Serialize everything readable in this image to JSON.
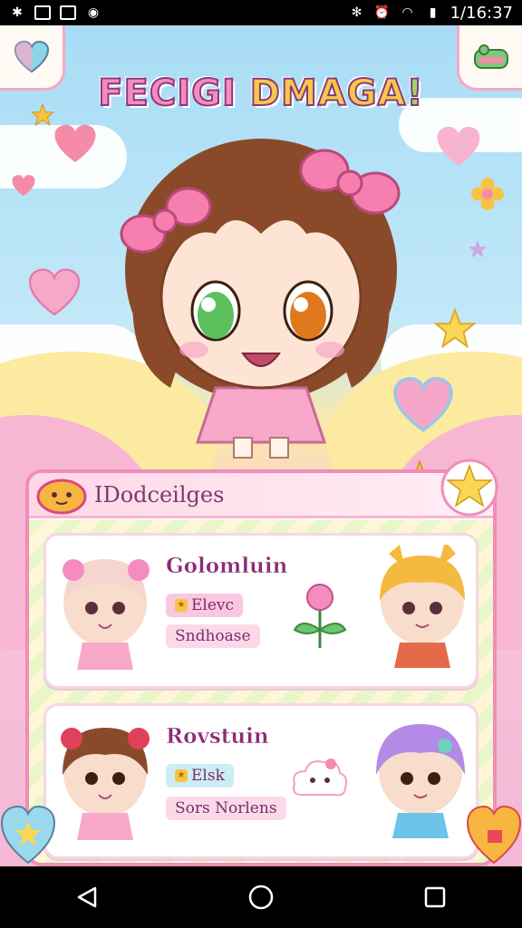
{
  "status_bar": {
    "time": "1/16:37",
    "left_icons": [
      "bluetooth-icon",
      "notification-icon",
      "app-icon",
      "sync-icon"
    ],
    "right_icons": [
      "bluetooth-icon",
      "alarm-icon",
      "wifi-icon",
      "signal-icon"
    ]
  },
  "header": {
    "title_part1": "FECIGI ",
    "title_part2": "DMAGA",
    "title_part3": "!",
    "left_button_icon": "heart-icon",
    "right_button_icon": "shop-icon"
  },
  "panel": {
    "title": "IDodceilges",
    "badge_icon": "star-icon",
    "entries": [
      {
        "name": "Golomluin",
        "tag1": "Elevc",
        "tag2": "Sndhoase",
        "item_icon": "flower-icon"
      },
      {
        "name": "Rovstuin",
        "tag1": "Elsk",
        "tag2": "Sors Norlens",
        "item_icon": "cloud-icon"
      }
    ]
  },
  "colors": {
    "accent_pink": "#f08dba",
    "title_purple": "#8a2d78",
    "sky_blue": "#a8dcf6",
    "yellow": "#f6c343"
  }
}
